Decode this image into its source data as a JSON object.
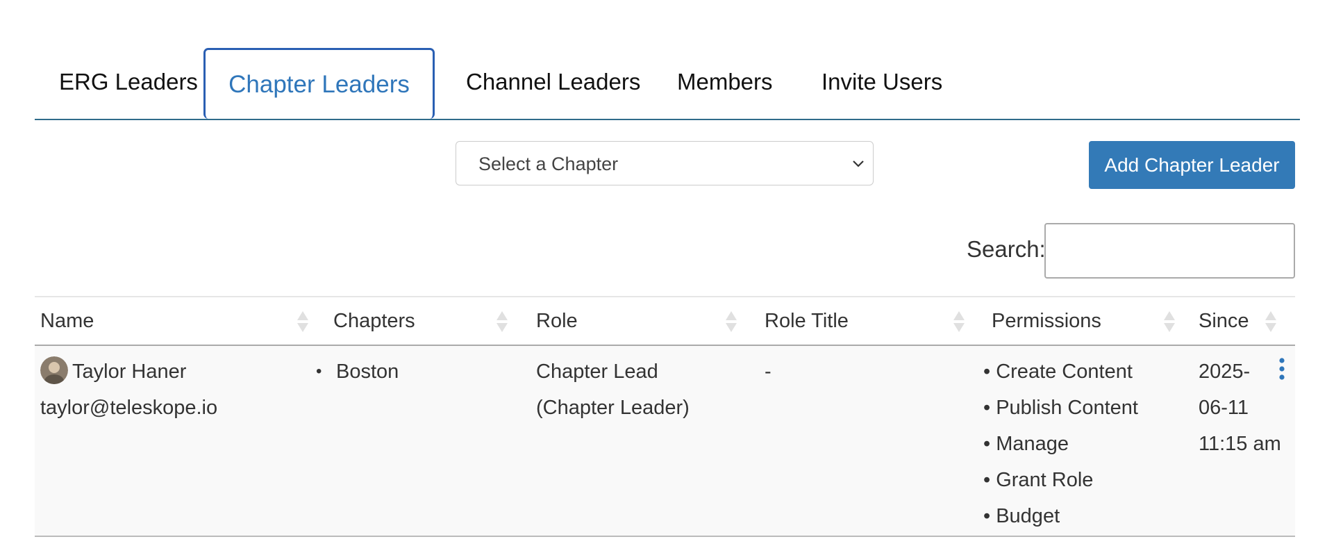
{
  "tabs": [
    {
      "label": "ERG Leaders",
      "active": false
    },
    {
      "label": "Chapter Leaders",
      "active": true
    },
    {
      "label": "Channel Leaders",
      "active": false
    },
    {
      "label": "Members",
      "active": false
    },
    {
      "label": "Invite Users",
      "active": false
    }
  ],
  "chapter_select": {
    "selected": "Select a Chapter"
  },
  "add_button": {
    "label": "Add Chapter Leader"
  },
  "search": {
    "label": "Search:",
    "value": ""
  },
  "table": {
    "headers": [
      "Name",
      "Chapters",
      "Role",
      "Role Title",
      "Permissions",
      "Since"
    ],
    "rows": [
      {
        "name": "Taylor Haner",
        "email": "taylor@teleskope.io",
        "chapters": [
          "Boston"
        ],
        "role_line1": "Chapter Lead",
        "role_line2": "(Chapter Leader)",
        "role_title": "-",
        "permissions": [
          "• Create Content",
          "• Publish Content",
          "• Manage",
          "• Grant Role",
          "• Budget"
        ],
        "since_line1": "2025-",
        "since_line2": "06-11",
        "since_line3": "11:15 am"
      }
    ]
  },
  "colors": {
    "accent": "#337ab7",
    "active_tab_text": "#2f76ba",
    "active_tab_border": "#2a5fb3",
    "tab_underline": "#2f6b8a",
    "row_background": "#f9f9f9"
  },
  "icons": {
    "select_chevron": "chevron-down-icon",
    "sort": "sort-icon",
    "row_menu": "kebab-menu-icon",
    "avatar": "avatar"
  }
}
